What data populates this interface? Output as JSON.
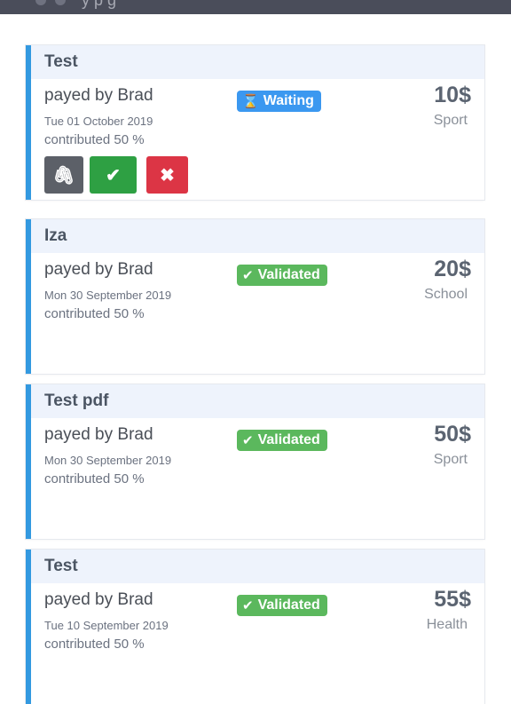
{
  "topbar": {
    "title": "y          p       g"
  },
  "cards": [
    {
      "title": "Test",
      "payer": "payed by Brad",
      "date": "Tue 01 October 2019",
      "contribution": "contributed 50 %",
      "status": {
        "label": "Waiting",
        "icon": "hourglass-icon",
        "symbol": "⌛"
      },
      "amount": "10$",
      "category": "Sport",
      "actions": {
        "attach_symbol": "🖇",
        "accept_symbol": "✔",
        "reject_symbol": "✖"
      }
    },
    {
      "title": "Iza",
      "payer": "payed by Brad",
      "date": "Mon 30 September 2019",
      "contribution": "contributed 50 %",
      "status": {
        "label": "Validated",
        "icon": "check-icon",
        "symbol": "✔"
      },
      "amount": "20$",
      "category": "School"
    },
    {
      "title": "Test pdf",
      "payer": "payed by Brad",
      "date": "Mon 30 September 2019",
      "contribution": "contributed 50 %",
      "status": {
        "label": "Validated",
        "icon": "check-icon",
        "symbol": "✔"
      },
      "amount": "50$",
      "category": "Sport"
    },
    {
      "title": "Test",
      "payer": "payed by Brad",
      "date": "Tue 10 September 2019",
      "contribution": "contributed 50 %",
      "status": {
        "label": "Validated",
        "icon": "check-icon",
        "symbol": "✔"
      },
      "amount": "55$",
      "category": "Health"
    }
  ],
  "colors": {
    "accent": "#3399e0",
    "waiting": "#3b98f0",
    "validated": "#5bb85d",
    "accept": "#2ea043",
    "reject": "#dc3545",
    "attach": "#5c6068"
  }
}
